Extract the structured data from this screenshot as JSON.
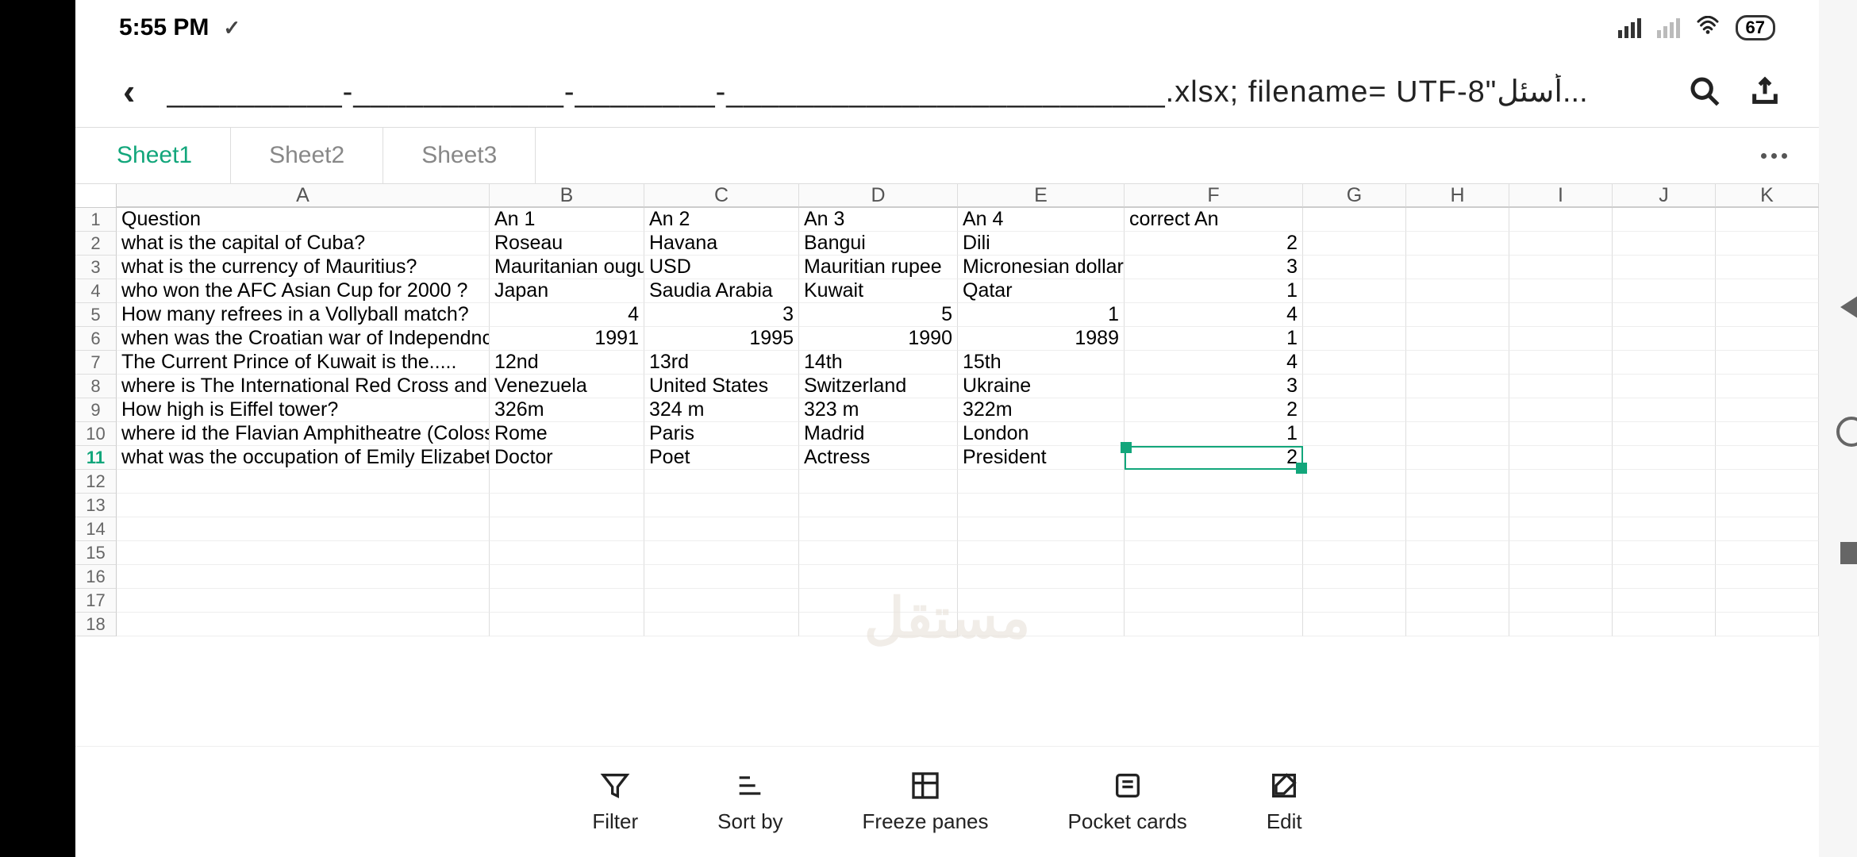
{
  "status": {
    "time": "5:55 PM",
    "battery": "67"
  },
  "title": {
    "filename": "__________-____________-________-_________________________.xlsx; filename= UTF-8\"",
    "arabic": "أسئل..."
  },
  "tabs": [
    "Sheet1",
    "Sheet2",
    "Sheet3"
  ],
  "activeTab": 0,
  "columns": [
    "A",
    "B",
    "C",
    "D",
    "E",
    "F",
    "G",
    "H",
    "I",
    "J",
    "K"
  ],
  "rowsShown": 18,
  "activeRow": 11,
  "selectedCell": {
    "row": 11,
    "col": "F"
  },
  "toolbar": {
    "filter": "Filter",
    "sort": "Sort by",
    "freeze": "Freeze panes",
    "pocket": "Pocket cards",
    "edit": "Edit"
  },
  "watermark": "مستقل",
  "cells": {
    "1": {
      "A": "Question",
      "B": "An 1",
      "C": "An 2",
      "D": "An 3",
      "E": "An 4",
      "F": "correct An"
    },
    "2": {
      "A": "what is the capital of Cuba?",
      "B": "Roseau",
      "C": "Havana",
      "D": "Bangui",
      "E": "Dili",
      "F": "2",
      "Fnum": true
    },
    "3": {
      "A": "what is the currency of Mauritius?",
      "B": "Mauritanian ouguiya",
      "C": "USD",
      "D": "Mauritian rupee",
      "E": "Micronesian dollar",
      "F": "3",
      "Fnum": true
    },
    "4": {
      "A": "who won the AFC Asian Cup for 2000 ?",
      "B": "Japan",
      "C": "Saudia Arabia",
      "D": "Kuwait",
      "E": "Qatar",
      "F": "1",
      "Fnum": true
    },
    "5": {
      "A": "How many refrees in a Vollyball match?",
      "B": "4",
      "Bnum": true,
      "C": "3",
      "Cnum": true,
      "D": "5",
      "Dnum": true,
      "E": "1",
      "Enum": true,
      "F": "4",
      "Fnum": true
    },
    "6": {
      "A": "when was the Croatian war of Independnce start ?",
      "B": "1991",
      "Bnum": true,
      "C": "1995",
      "Cnum": true,
      "D": "1990",
      "Dnum": true,
      "E": "1989",
      "Enum": true,
      "F": "1",
      "Fnum": true
    },
    "7": {
      "A": "The Current Prince of Kuwait is the.....",
      "B": "12nd",
      "C": "13rd",
      "D": "14th",
      "E": "15th",
      "F": "4",
      "Fnum": true
    },
    "8": {
      "A": "where is The International Red Cross and Red Crescent",
      "B": "Venezuela",
      "C": "United States",
      "D": "Switzerland",
      "E": "Ukraine",
      "F": "3",
      "Fnum": true
    },
    "9": {
      "A": "How high is Eiffel tower?",
      "B": "326m",
      "C": "324 m",
      "D": "323 m",
      "E": "322m",
      "F": "2",
      "Fnum": true
    },
    "10": {
      "A": "where id the Flavian Amphitheatre (Colosseum)",
      "B": "Rome",
      "C": "Paris",
      "D": "Madrid",
      "E": "London",
      "F": "1",
      "Fnum": true
    },
    "11": {
      "A": "what was the occupation of Emily Elizabeth Dickinson",
      "B": "Doctor",
      "C": "Poet",
      "D": "Actress",
      "E": "President",
      "F": "2",
      "Fnum": true
    }
  }
}
